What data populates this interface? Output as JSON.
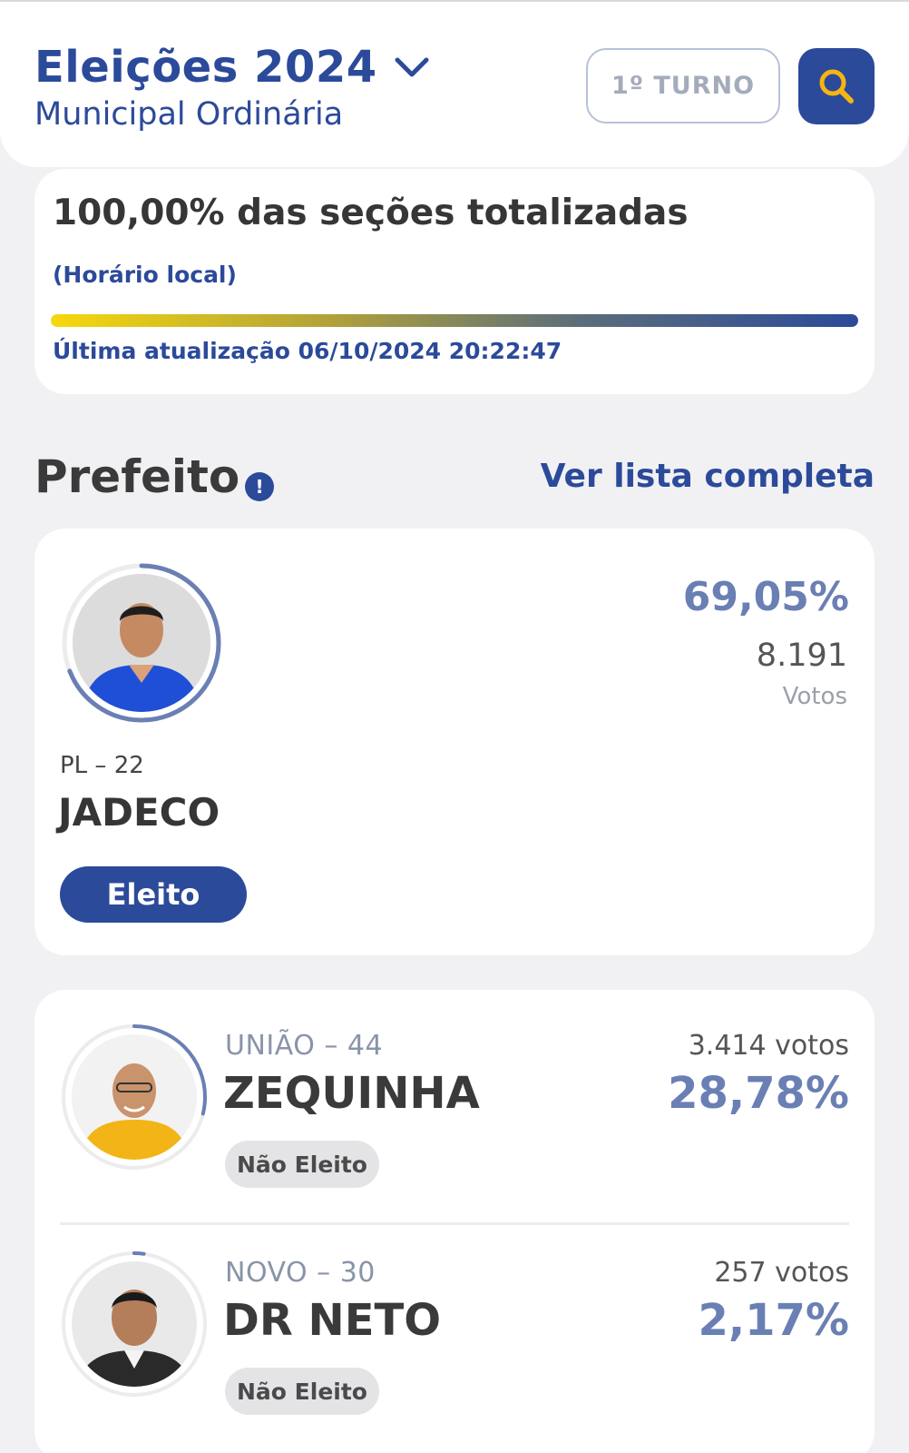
{
  "header": {
    "title": "Eleições 2024",
    "subtitle": "Municipal Ordinária",
    "turno_label": "1º TURNO",
    "search_icon": "search-icon",
    "dropdown_icon": "chevron-down-icon"
  },
  "status": {
    "headline": "100,00% das seções totalizadas",
    "progress_pct": 100,
    "local_time_note": "(Horário local)",
    "last_update": "Última atualização 06/10/2024 20:22:47"
  },
  "section": {
    "title": "Prefeito",
    "info_icon": "!",
    "see_all_label": "Ver lista completa"
  },
  "winner": {
    "party": "PL – 22",
    "name": "JADECO",
    "percent": "69,05%",
    "percent_value": 69.05,
    "votes": "8.191",
    "votes_label": "Votos",
    "status": "Eleito"
  },
  "candidates": [
    {
      "party": "UNIÃO – 44",
      "name": "ZEQUINHA",
      "votes": "3.414 votos",
      "percent": "28,78%",
      "percent_value": 28.78,
      "status": "Não Eleito"
    },
    {
      "party": "NOVO – 30",
      "name": "DR NETO",
      "votes": "257 votos",
      "percent": "2,17%",
      "percent_value": 2.17,
      "status": "Não Eleito"
    }
  ],
  "colors": {
    "primary": "#2c4a9a",
    "accent_search": "#f6b511",
    "ring": "#6a7fb3",
    "ring_track": "#ececee"
  }
}
